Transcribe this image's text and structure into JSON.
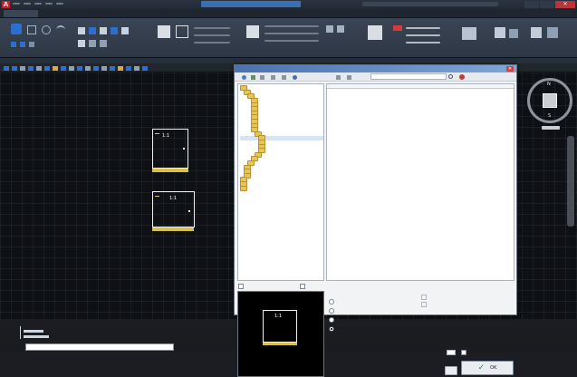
{
  "window": {
    "title": ""
  },
  "ribbon": {
    "tabs": [
      "",
      "",
      "",
      "",
      "",
      "",
      "",
      "",
      "",
      "",
      "",
      "",
      "",
      ""
    ],
    "panel_labels": [
      "",
      "",
      "",
      "",
      "",
      "",
      "",
      "",
      "",
      "",
      ""
    ]
  },
  "drawing": {
    "file_tab": "",
    "frames": [
      {
        "scale_label": "1:1",
        "caption": ""
      },
      {
        "scale_label": "1:1",
        "caption": ""
      }
    ]
  },
  "viewcube": {
    "north": "N",
    "south": "S"
  },
  "command_line": {
    "history": [
      "",
      ""
    ],
    "input": ""
  },
  "dialog": {
    "title": "",
    "search_placeholder": "",
    "tree_items": [
      "",
      "",
      "",
      "",
      "",
      "",
      "",
      "",
      "",
      "",
      "",
      "",
      "",
      "",
      "",
      "",
      "",
      "",
      "",
      "",
      "",
      "",
      "",
      "",
      ""
    ],
    "list_headers": {
      "name": "",
      "modified": ""
    },
    "list_rows": [
      {
        "name": "",
        "modified": ""
      },
      {
        "name": "",
        "modified": ""
      },
      {
        "name": "",
        "modified": ""
      },
      {
        "name": "",
        "modified": ""
      },
      {
        "name": "",
        "modified": ""
      },
      {
        "name": "",
        "modified": ""
      },
      {
        "name": "",
        "modified": ""
      },
      {
        "name": "",
        "modified": ""
      }
    ],
    "bottom_checkboxes": [
      "",
      ""
    ],
    "options_group_label": "",
    "radio_options": [
      "",
      "",
      "",
      ""
    ],
    "right_group_label": "",
    "right_options": [
      "",
      ""
    ],
    "field_label_a": "",
    "field_label_b": "",
    "field_value_b": "",
    "checkbox_right": "",
    "preview_scale": "1:1",
    "preview_caption": "",
    "path_label": "",
    "path_value": "",
    "ok_label": "OK",
    "cancel_label": ""
  }
}
